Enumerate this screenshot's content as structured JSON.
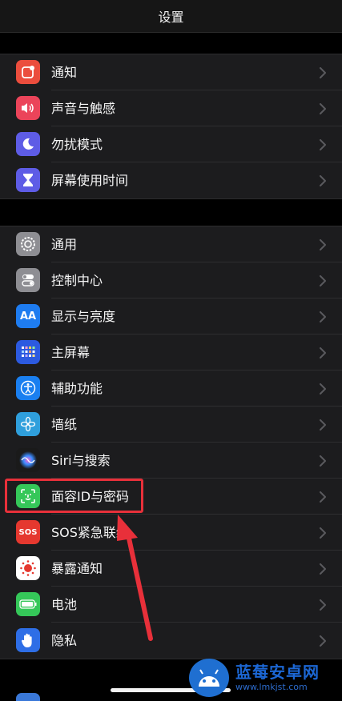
{
  "nav": {
    "title": "设置"
  },
  "group1": [
    {
      "key": "notifications",
      "label": "通知",
      "icon": "notification-icon",
      "color": "#eb4d3d"
    },
    {
      "key": "sounds",
      "label": "声音与触感",
      "icon": "speaker-icon",
      "color": "#eb445a"
    },
    {
      "key": "dnd",
      "label": "勿扰模式",
      "icon": "moon-icon",
      "color": "#5e5ce6"
    },
    {
      "key": "screentime",
      "label": "屏幕使用时间",
      "icon": "hourglass-icon",
      "color": "#5e5ce6"
    }
  ],
  "group2": [
    {
      "key": "general",
      "label": "通用",
      "icon": "gear-icon",
      "color": "#8e8e93"
    },
    {
      "key": "control",
      "label": "控制中心",
      "icon": "toggles-icon",
      "color": "#8e8e93"
    },
    {
      "key": "display",
      "label": "显示与亮度",
      "icon": "text-size-icon",
      "color": "#1e7cf0",
      "glyph": "AA"
    },
    {
      "key": "home",
      "label": "主屏幕",
      "icon": "home-grid-icon",
      "color": "#2c5ae0"
    },
    {
      "key": "accessibility",
      "label": "辅助功能",
      "icon": "accessibility-icon",
      "color": "#1a7ff0"
    },
    {
      "key": "wallpaper",
      "label": "墙纸",
      "icon": "flower-icon",
      "color": "#2f9fdc"
    },
    {
      "key": "siri",
      "label": "Siri与搜索",
      "icon": "siri-icon",
      "color": "#1a1a1a"
    },
    {
      "key": "faceid",
      "label": "面容ID与密码",
      "icon": "face-id-icon",
      "color": "#35c759"
    },
    {
      "key": "sos",
      "label": "SOS紧急联络",
      "icon": "sos-icon",
      "color": "#e5382f",
      "glyph": "SOS"
    },
    {
      "key": "exposure",
      "label": "暴露通知",
      "icon": "exposure-icon",
      "color": "#ffffff"
    },
    {
      "key": "battery",
      "label": "电池",
      "icon": "battery-icon",
      "color": "#35c759"
    },
    {
      "key": "privacy",
      "label": "隐私",
      "icon": "hand-icon",
      "color": "#2e6ee6"
    }
  ],
  "watermark": {
    "title": "蓝莓安卓网",
    "url": "www.lmkjst.com"
  },
  "colors": {
    "highlight": "#e8303a",
    "group_bg": "#1c1c1e",
    "chevron": "#5a5a5e"
  }
}
